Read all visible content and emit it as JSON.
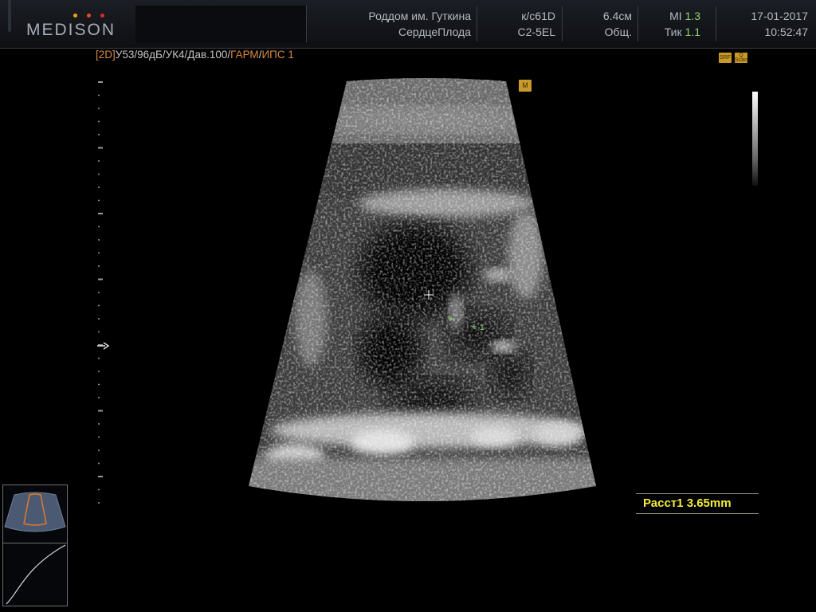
{
  "header": {
    "brand": "MEDISON",
    "brand_dot_colors": [
      "#f0a020",
      "#e84a2a",
      "#e02828"
    ],
    "hospital": "Роддом им. Гуткина",
    "exam": "СердцеПлода",
    "probe_code": "к/с61D",
    "probe_model": "C2-5EL",
    "depth": "6.4см",
    "preset": "Общ.",
    "mi_label": "MI",
    "mi_value": "1.3",
    "tic_label": "Тик",
    "tic_value": "1.1",
    "date": "17-01-2017",
    "time": "10:52:47"
  },
  "mode_line": {
    "mode": "[2D]",
    "params": "У53/96дБ/УК4/Дав.100/",
    "harmonic": "ГАРМ",
    "separator": "/",
    "ips": "ИПС 1"
  },
  "badges": {
    "srf": "SRF",
    "scan": "Q Scan",
    "orientation": "M"
  },
  "measurement": {
    "caliper_label": "1",
    "readout": "Расст1 3.65mm"
  },
  "colors": {
    "measure_yellow": "#f2ec3c",
    "caliper_green": "#8fe07a",
    "orange_text": "#d8893f",
    "badge_gold": "#c99a2a",
    "mi_green": "#8fd470"
  }
}
